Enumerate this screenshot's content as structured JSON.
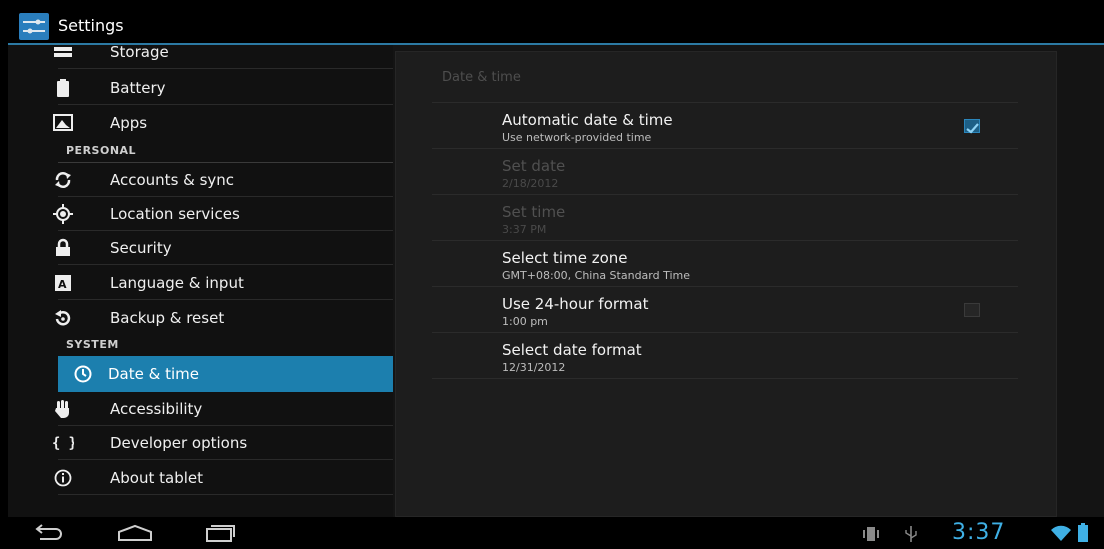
{
  "app": {
    "title": "Settings"
  },
  "sidebar": {
    "items_top": [
      {
        "label": "Storage",
        "icon": "storage-icon"
      },
      {
        "label": "Battery",
        "icon": "battery-icon"
      },
      {
        "label": "Apps",
        "icon": "apps-icon"
      }
    ],
    "personal_header": "PERSONAL",
    "items_personal": [
      {
        "label": "Accounts & sync",
        "icon": "sync-icon"
      },
      {
        "label": "Location services",
        "icon": "location-icon"
      },
      {
        "label": "Security",
        "icon": "lock-icon"
      },
      {
        "label": "Language & input",
        "icon": "keyboard-icon"
      },
      {
        "label": "Backup & reset",
        "icon": "backup-icon"
      }
    ],
    "system_header": "SYSTEM",
    "selected": {
      "label": "Date & time",
      "icon": "clock-icon"
    },
    "items_system": [
      {
        "label": "Accessibility",
        "icon": "hand-icon"
      },
      {
        "label": "Developer options",
        "icon": "braces-icon"
      },
      {
        "label": "About tablet",
        "icon": "info-icon"
      }
    ]
  },
  "detail": {
    "header": "Date & time",
    "prefs": [
      {
        "title": "Automatic date & time",
        "summary": "Use network-provided time",
        "enabled": true,
        "checkbox": true,
        "checked": true
      },
      {
        "title": "Set date",
        "summary": "2/18/2012",
        "enabled": false
      },
      {
        "title": "Set time",
        "summary": "3:37 PM",
        "enabled": false
      },
      {
        "title": "Select time zone",
        "summary": "GMT+08:00, China Standard Time",
        "enabled": true
      },
      {
        "title": "Use 24-hour format",
        "summary": "1:00 pm",
        "enabled": true,
        "checkbox": true,
        "checked": false
      },
      {
        "title": "Select date format",
        "summary": "12/31/2012",
        "enabled": true
      }
    ]
  },
  "statusbar": {
    "clock": "3:37"
  },
  "colors": {
    "accent": "#1c7fae",
    "clock": "#3fb0e5"
  }
}
